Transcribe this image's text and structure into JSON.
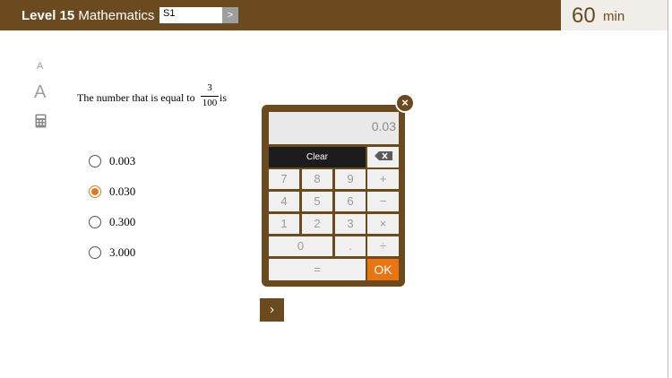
{
  "header": {
    "level": "Level 15",
    "subject": "Mathematics",
    "section_value": "S1",
    "section_arrow": ">",
    "timer_value": "60",
    "timer_unit": "min"
  },
  "tools": {
    "font_small": "A",
    "font_large": "A",
    "calculator": "calculator-icon"
  },
  "question": {
    "prefix": "The number that is equal to",
    "numerator": "3",
    "denominator": "100",
    "suffix": "is"
  },
  "options": [
    {
      "label": "0.003",
      "selected": false
    },
    {
      "label": "0.030",
      "selected": true
    },
    {
      "label": "0.300",
      "selected": false
    },
    {
      "label": "3.000",
      "selected": false
    }
  ],
  "calculator": {
    "display": "0.03",
    "close_label": "×",
    "clear_label": "Clear",
    "backspace_icon": "backspace-icon",
    "keys": {
      "k7": "7",
      "k8": "8",
      "k9": "9",
      "plus": "+",
      "k4": "4",
      "k5": "5",
      "k6": "6",
      "minus": "−",
      "k1": "1",
      "k2": "2",
      "k3": "3",
      "times": "×",
      "k0": "0",
      "dot": ".",
      "divide": "÷",
      "equals": "=",
      "ok": "OK"
    }
  },
  "nav": {
    "next": "›"
  },
  "colors": {
    "brand": "#6b4a1f",
    "accent": "#e87511"
  }
}
